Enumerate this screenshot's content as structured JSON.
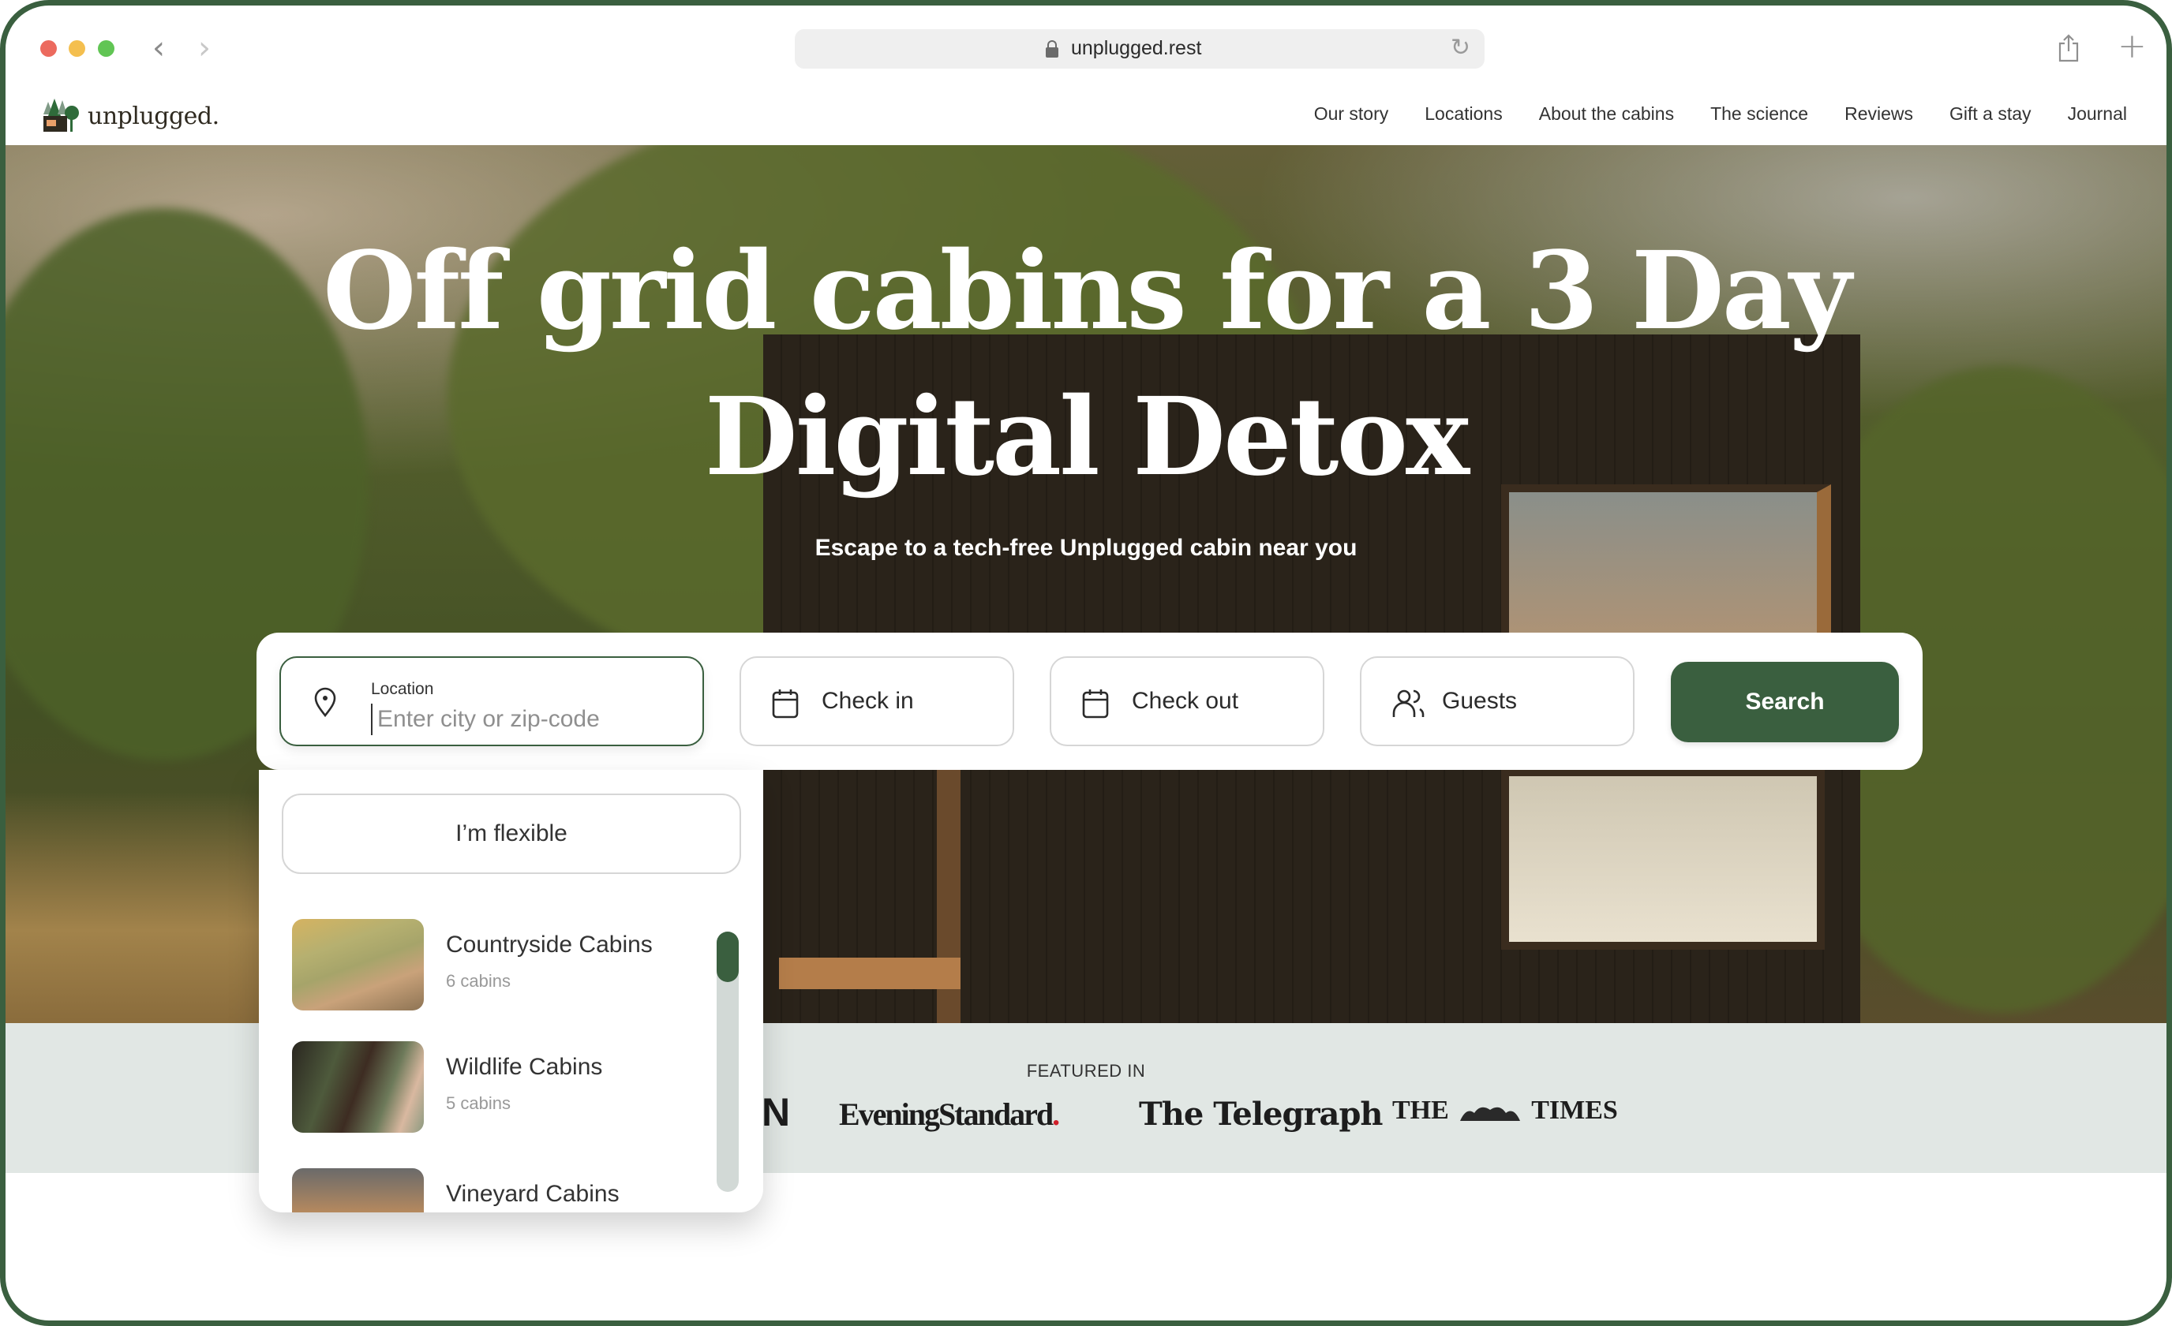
{
  "browser": {
    "url": "unplugged.rest",
    "back_icon": "chevron-left-icon",
    "forward_icon": "chevron-right-icon",
    "reload_icon": "reload-icon",
    "share_icon": "share-icon",
    "new_tab_icon": "plus-icon"
  },
  "header": {
    "brand": "unplugged.",
    "nav": [
      "Our story",
      "Locations",
      "About the cabins",
      "The science",
      "Reviews",
      "Gift a stay",
      "Journal"
    ]
  },
  "hero": {
    "title_line1": "Off grid cabins for a 3 Day",
    "title_line2": "Digital Detox",
    "subtitle": "Escape to a tech-free Unplugged cabin near you"
  },
  "search": {
    "location_label": "Location",
    "location_placeholder": "Enter city or zip-code",
    "location_value": "",
    "checkin_label": "Check in",
    "checkout_label": "Check out",
    "guests_label": "Guests",
    "search_button": "Search"
  },
  "dropdown": {
    "flexible_label": "I’m flexible",
    "items": [
      {
        "name": "Countryside Cabins",
        "count": "6 cabins"
      },
      {
        "name": "Wildlife Cabins",
        "count": "5 cabins"
      },
      {
        "name": "Vineyard Cabins",
        "count": ""
      }
    ]
  },
  "featured": {
    "label": "FEATURED IN",
    "outlets": [
      "N",
      "EveningStandard",
      "The Telegraph",
      "THE",
      "TIMES"
    ]
  },
  "colors": {
    "brand_green": "#3a5f3f",
    "featured_bg": "#e1e7e4"
  }
}
